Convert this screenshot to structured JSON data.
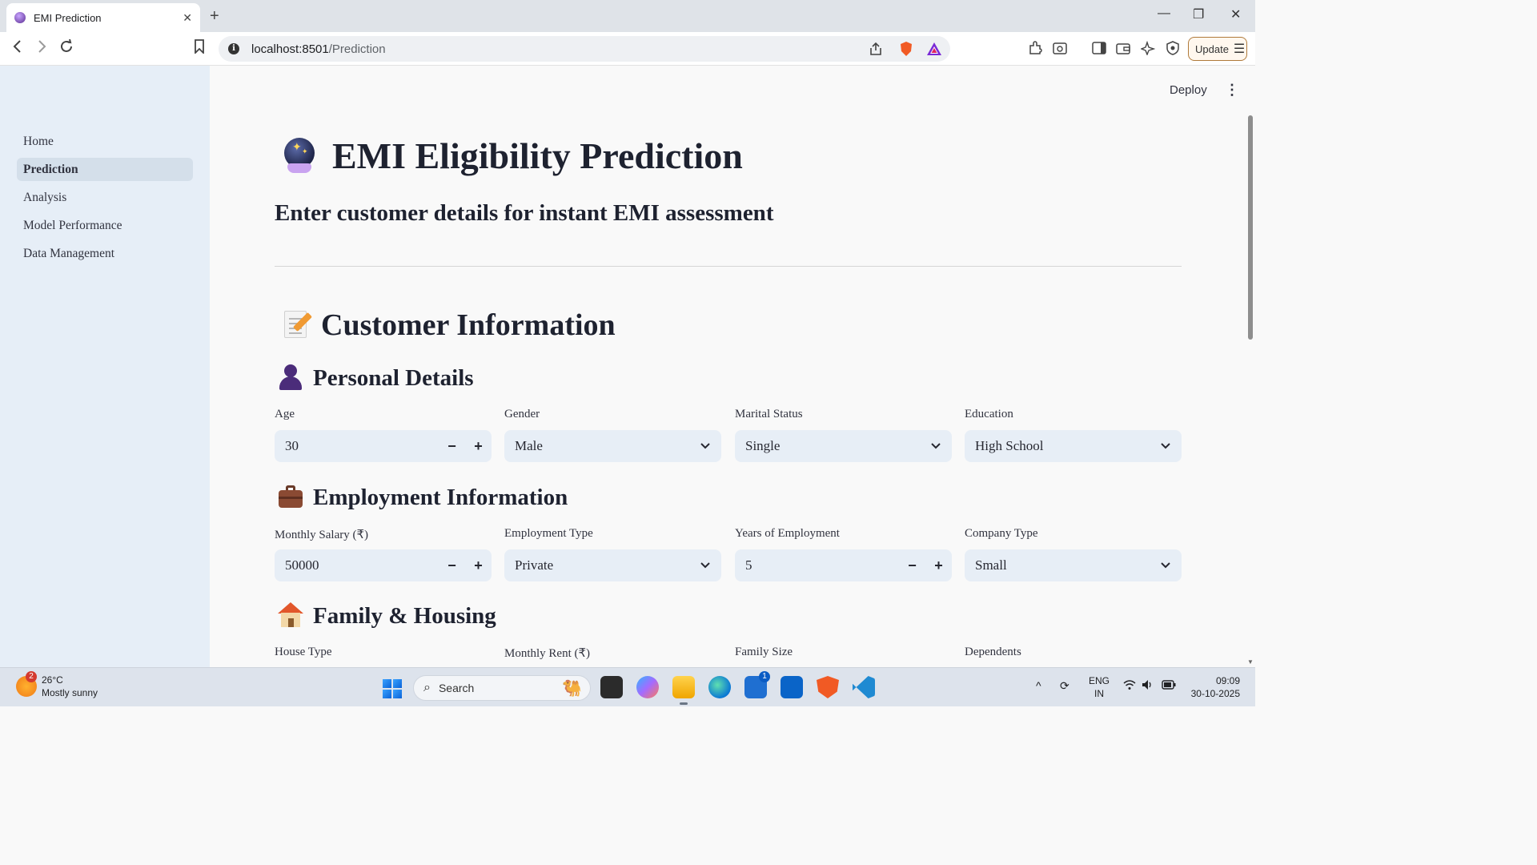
{
  "browser": {
    "tab_title": "EMI Prediction",
    "new_tab": "+",
    "url_host": "localhost:8501",
    "url_path": "/Prediction",
    "update_label": "Update"
  },
  "sidebar": {
    "items": [
      {
        "label": "Home"
      },
      {
        "label": "Prediction"
      },
      {
        "label": "Analysis"
      },
      {
        "label": "Model Performance"
      },
      {
        "label": "Data Management"
      }
    ],
    "active": "Prediction"
  },
  "header": {
    "deploy_label": "Deploy",
    "menu_icon": "⋮"
  },
  "page": {
    "title": "EMI Eligibility Prediction",
    "subtitle": "Enter customer details for instant EMI assessment",
    "section_title": "Customer Information",
    "personal": {
      "heading": "Personal Details",
      "age_label": "Age",
      "age_value": "30",
      "gender_label": "Gender",
      "gender_value": "Male",
      "marital_label": "Marital Status",
      "marital_value": "Single",
      "education_label": "Education",
      "education_value": "High School"
    },
    "employment": {
      "heading": "Employment Information",
      "salary_label": "Monthly Salary (₹)",
      "salary_value": "50000",
      "type_label": "Employment Type",
      "type_value": "Private",
      "years_label": "Years of Employment",
      "years_value": "5",
      "company_label": "Company Type",
      "company_value": "Small"
    },
    "family": {
      "heading": "Family & Housing",
      "house_label": "House Type",
      "rent_label": "Monthly Rent (₹)",
      "size_label": "Family Size",
      "dependents_label": "Dependents"
    },
    "stepper_minus": "−",
    "stepper_plus": "+"
  },
  "taskbar": {
    "weather_temp": "26°C",
    "weather_desc": "Mostly sunny",
    "weather_badge": "2",
    "search_label": "Search",
    "store_badge": "1",
    "lang_top": "ENG",
    "lang_bottom": "IN",
    "time": "09:09",
    "date": "30-10-2025"
  },
  "colors": {
    "sidebar_bg": "#e6eef7",
    "main_bg": "#f9f9f9",
    "input_bg": "#e7eef6",
    "taskbar_bg": "#dde3ec"
  }
}
